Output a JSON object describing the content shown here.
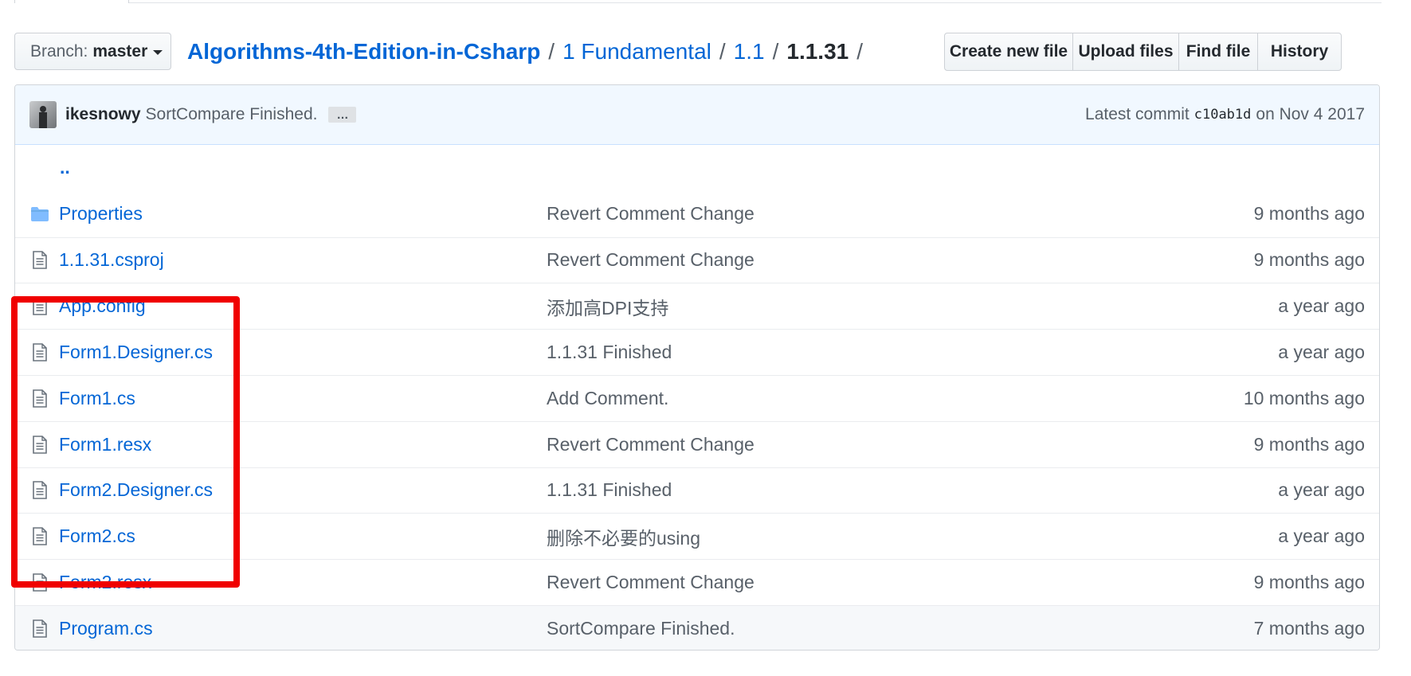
{
  "branch": {
    "label": "Branch:",
    "value": "master"
  },
  "breadcrumb": {
    "repo": "Algorithms-4th-Edition-in-Csharp",
    "parts": [
      "1 Fundamental",
      "1.1"
    ],
    "current": "1.1.31",
    "separator": "/"
  },
  "actions": [
    "Create new file",
    "Upload files",
    "Find file",
    "History"
  ],
  "commit": {
    "author": "ikesnowy",
    "message": "SortCompare Finished.",
    "ellipsis": "…",
    "latest_label": "Latest commit",
    "sha": "c10ab1d",
    "date": "on Nov 4 2017"
  },
  "parent_link": "..",
  "files": [
    {
      "name": "Properties",
      "type": "folder",
      "message": "Revert Comment Change",
      "age": "9 months ago"
    },
    {
      "name": "1.1.31.csproj",
      "type": "file",
      "message": "Revert Comment Change",
      "age": "9 months ago"
    },
    {
      "name": "App.config",
      "type": "file",
      "message": "添加高DPI支持",
      "age": "a year ago"
    },
    {
      "name": "Form1.Designer.cs",
      "type": "file",
      "message": "1.1.31 Finished",
      "age": "a year ago"
    },
    {
      "name": "Form1.cs",
      "type": "file",
      "message": "Add Comment.",
      "age": "10 months ago"
    },
    {
      "name": "Form1.resx",
      "type": "file",
      "message": "Revert Comment Change",
      "age": "9 months ago"
    },
    {
      "name": "Form2.Designer.cs",
      "type": "file",
      "message": "1.1.31 Finished",
      "age": "a year ago"
    },
    {
      "name": "Form2.cs",
      "type": "file",
      "message": "删除不必要的using",
      "age": "a year ago"
    },
    {
      "name": "Form2.resx",
      "type": "file",
      "message": "Revert Comment Change",
      "age": "9 months ago"
    },
    {
      "name": "Program.cs",
      "type": "file",
      "message": "SortCompare Finished.",
      "age": "7 months ago"
    }
  ],
  "colors": {
    "link": "#0366d6",
    "highlight": "#f00000",
    "commit_bg": "#f1f8ff"
  },
  "icons": {
    "folder": "folder-icon",
    "file": "file-text-icon",
    "branch_caret": "chevron-down-icon"
  }
}
